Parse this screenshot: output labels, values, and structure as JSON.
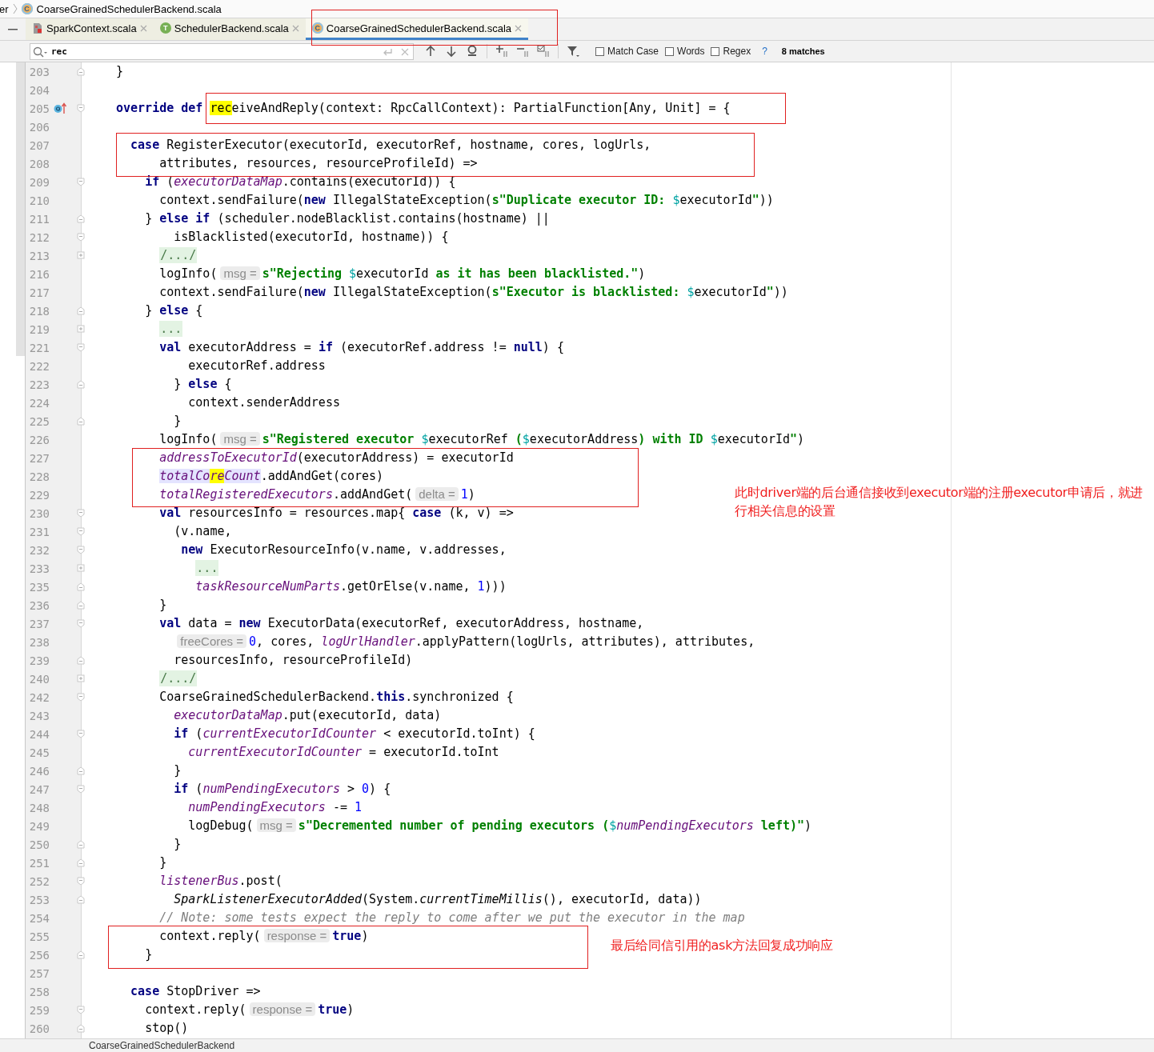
{
  "breadcrumb": {
    "lead": "er",
    "file": "CoarseGrainedSchedulerBackend.scala",
    "badge": "C"
  },
  "tabs": [
    {
      "label": "SparkContext.scala",
      "kind": "file",
      "selected": false
    },
    {
      "label": "SchedulerBackend.scala",
      "kind": "trait",
      "badge": "T",
      "selected": false
    },
    {
      "label": "CoarseGrainedSchedulerBackend.scala",
      "kind": "class",
      "badge": "C",
      "selected": true
    }
  ],
  "search": {
    "value": "rec",
    "options": [
      {
        "label": "Match Case",
        "checked": false
      },
      {
        "label": "Words",
        "checked": false
      },
      {
        "label": "Regex",
        "checked": false
      }
    ],
    "help": "?",
    "matches": "8 matches"
  },
  "editor": {
    "lines": [
      {
        "num": "203",
        "fold": {
          "kind": "end"
        },
        "tokens": [
          {
            "kind": "t",
            "text": "}"
          }
        ]
      },
      {
        "num": "204"
      },
      {
        "num": "205",
        "fold": {
          "kind": "start"
        },
        "gutter_icon": {
          "kind": "override"
        },
        "tokens": [
          {
            "kind": "kw",
            "text": "override"
          },
          {
            "kind": "kw",
            "text": " def "
          },
          {
            "kind": "match",
            "text": "rec"
          },
          {
            "kind": "t",
            "text": "eiveAndReply(context: RpcCallContext): PartialFunction[Any, Unit] = {"
          }
        ]
      },
      {
        "num": "206"
      },
      {
        "num": "207",
        "tokens": [
          {
            "kind": "kw",
            "text": "  case"
          },
          {
            "kind": "t",
            "text": " RegisterExecutor(executorId, executorRef, hostname, cores, logUrls,"
          }
        ]
      },
      {
        "num": "208",
        "tokens": [
          {
            "kind": "t",
            "text": "      attributes, resources, resourceProfileId) =>"
          }
        ]
      },
      {
        "num": "209",
        "fold": {
          "kind": "start"
        },
        "tokens": [
          {
            "kind": "kw",
            "text": "    if"
          },
          {
            "kind": "t",
            "text": " ("
          },
          {
            "kind": "fld",
            "text": "executorDataMap"
          },
          {
            "kind": "t",
            "text": ".contains(executorId)) {"
          }
        ]
      },
      {
        "num": "210",
        "tokens": [
          {
            "kind": "t",
            "text": "      context.sendFailure("
          },
          {
            "kind": "kw",
            "text": "new"
          },
          {
            "kind": "t",
            "text": " IllegalStateException("
          },
          {
            "kind": "str",
            "text": "s\"Duplicate executor ID: "
          },
          {
            "kind": "var",
            "text": "$"
          },
          {
            "kind": "t",
            "text": "executorId"
          },
          {
            "kind": "str",
            "text": "\""
          },
          {
            "kind": "t",
            "text": "))"
          }
        ]
      },
      {
        "num": "211",
        "fold": {
          "kind": "end"
        },
        "tokens": [
          {
            "kind": "t",
            "text": "    } "
          },
          {
            "kind": "kw",
            "text": "else"
          },
          {
            "kind": "kw",
            "text": " if"
          },
          {
            "kind": "t",
            "text": " (scheduler.nodeBlacklist.contains(hostname) ||"
          }
        ]
      },
      {
        "num": "212",
        "fold": {
          "kind": "start"
        },
        "tokens": [
          {
            "kind": "t",
            "text": "        isBlacklisted(executorId, hostname)) {"
          }
        ]
      },
      {
        "num": "213",
        "fold": {
          "kind": "collapsed"
        },
        "tokens": [
          {
            "kind": "fold",
            "text": "      /.../"
          }
        ]
      },
      {
        "num": "216",
        "tokens": [
          {
            "kind": "t",
            "text": "      logInfo("
          },
          {
            "kind": "hint",
            "text": "msg ="
          },
          {
            "kind": "str",
            "text": "s\"Rejecting "
          },
          {
            "kind": "var",
            "text": "$"
          },
          {
            "kind": "t",
            "text": "executorId"
          },
          {
            "kind": "str",
            "text": " as it has been blacklisted.\""
          },
          {
            "kind": "t",
            "text": ")"
          }
        ]
      },
      {
        "num": "217",
        "tokens": [
          {
            "kind": "t",
            "text": "      context.sendFailure("
          },
          {
            "kind": "kw",
            "text": "new"
          },
          {
            "kind": "t",
            "text": " IllegalStateException("
          },
          {
            "kind": "str",
            "text": "s\"Executor is blacklisted: "
          },
          {
            "kind": "var",
            "text": "$"
          },
          {
            "kind": "t",
            "text": "executorId"
          },
          {
            "kind": "str",
            "text": "\""
          },
          {
            "kind": "t",
            "text": "))"
          }
        ]
      },
      {
        "num": "218",
        "fold": {
          "kind": "end"
        },
        "tokens": [
          {
            "kind": "t",
            "text": "    } "
          },
          {
            "kind": "kw",
            "text": "else"
          },
          {
            "kind": "t",
            "text": " {"
          }
        ]
      },
      {
        "num": "219",
        "fold": {
          "kind": "collapsed"
        },
        "tokens": [
          {
            "kind": "fold",
            "text": "      ..."
          }
        ]
      },
      {
        "num": "221",
        "fold": {
          "kind": "start"
        },
        "tokens": [
          {
            "kind": "kw",
            "text": "      val"
          },
          {
            "kind": "t",
            "text": " executorAddress = "
          },
          {
            "kind": "kw",
            "text": "if"
          },
          {
            "kind": "t",
            "text": " (executorRef.address != "
          },
          {
            "kind": "kw",
            "text": "null"
          },
          {
            "kind": "t",
            "text": ") {"
          }
        ]
      },
      {
        "num": "222",
        "tokens": [
          {
            "kind": "t",
            "text": "          executorRef.address"
          }
        ]
      },
      {
        "num": "223",
        "fold": {
          "kind": "end"
        },
        "tokens": [
          {
            "kind": "t",
            "text": "        } "
          },
          {
            "kind": "kw",
            "text": "else"
          },
          {
            "kind": "t",
            "text": " {"
          }
        ]
      },
      {
        "num": "224",
        "tokens": [
          {
            "kind": "t",
            "text": "          context.senderAddress"
          }
        ]
      },
      {
        "num": "225",
        "fold": {
          "kind": "end"
        },
        "tokens": [
          {
            "kind": "t",
            "text": "        }"
          }
        ]
      },
      {
        "num": "226",
        "tokens": [
          {
            "kind": "t",
            "text": "      logInfo("
          },
          {
            "kind": "hint",
            "text": "msg ="
          },
          {
            "kind": "str",
            "text": "s\"Registered executor "
          },
          {
            "kind": "var",
            "text": "$"
          },
          {
            "kind": "t",
            "text": "executorRef"
          },
          {
            "kind": "str",
            "text": " ("
          },
          {
            "kind": "var",
            "text": "$"
          },
          {
            "kind": "t",
            "text": "executorAddress"
          },
          {
            "kind": "str",
            "text": ") with ID "
          },
          {
            "kind": "var",
            "text": "$"
          },
          {
            "kind": "t",
            "text": "executorId"
          },
          {
            "kind": "str",
            "text": "\""
          },
          {
            "kind": "t",
            "text": ")"
          }
        ]
      },
      {
        "num": "227",
        "tokens": [
          {
            "kind": "fld",
            "text": "      addressToExecutorId"
          },
          {
            "kind": "t",
            "text": "(executorAddress) = executorId"
          }
        ]
      },
      {
        "num": "228",
        "tokens": [
          {
            "kind": "fldsel",
            "text": "      totalCo"
          },
          {
            "kind": "fldmatch",
            "text": "re"
          },
          {
            "kind": "fldsel",
            "text": "Count"
          },
          {
            "kind": "t",
            "text": ".addAndGet(cores)"
          }
        ]
      },
      {
        "num": "229",
        "tokens": [
          {
            "kind": "fld",
            "text": "      totalRegisteredExecutors"
          },
          {
            "kind": "t",
            "text": ".addAndGet("
          },
          {
            "kind": "hint",
            "text": "delta ="
          },
          {
            "kind": "num",
            "text": "1"
          },
          {
            "kind": "t",
            "text": ")"
          }
        ]
      },
      {
        "num": "230",
        "fold": {
          "kind": "start"
        },
        "tokens": [
          {
            "kind": "kw",
            "text": "      val"
          },
          {
            "kind": "t",
            "text": " resourcesInfo = resources.map{ "
          },
          {
            "kind": "kw",
            "text": "case"
          },
          {
            "kind": "t",
            "text": " (k, v) =>"
          }
        ]
      },
      {
        "num": "231",
        "fold": {
          "kind": "start"
        },
        "tokens": [
          {
            "kind": "t",
            "text": "        (v.name,"
          }
        ]
      },
      {
        "num": "232",
        "fold": {
          "kind": "start"
        },
        "tokens": [
          {
            "kind": "kw",
            "text": "         new"
          },
          {
            "kind": "t",
            "text": " ExecutorResourceInfo(v.name, v.addresses,"
          }
        ]
      },
      {
        "num": "233",
        "fold": {
          "kind": "collapsed"
        },
        "tokens": [
          {
            "kind": "fold",
            "text": "           ..."
          }
        ]
      },
      {
        "num": "235",
        "fold": {
          "kind": "end"
        },
        "tokens": [
          {
            "kind": "fld",
            "text": "           taskResourceNumParts"
          },
          {
            "kind": "t",
            "text": ".getOrElse(v.name, "
          },
          {
            "kind": "num",
            "text": "1"
          },
          {
            "kind": "t",
            "text": ")))"
          }
        ]
      },
      {
        "num": "236",
        "fold": {
          "kind": "end"
        },
        "tokens": [
          {
            "kind": "t",
            "text": "      }"
          }
        ]
      },
      {
        "num": "237",
        "fold": {
          "kind": "start"
        },
        "tokens": [
          {
            "kind": "kw",
            "text": "      val"
          },
          {
            "kind": "t",
            "text": " data = "
          },
          {
            "kind": "kw",
            "text": "new"
          },
          {
            "kind": "t",
            "text": " ExecutorData(executorRef, executorAddress, hostname,"
          }
        ]
      },
      {
        "num": "238",
        "tokens": [
          {
            "kind": "hint",
            "text": "        freeCores ="
          },
          {
            "kind": "num",
            "text": "0"
          },
          {
            "kind": "t",
            "text": ", cores, "
          },
          {
            "kind": "fld",
            "text": "logUrlHandler"
          },
          {
            "kind": "t",
            "text": ".applyPattern(logUrls, attributes), attributes,"
          }
        ]
      },
      {
        "num": "239",
        "fold": {
          "kind": "end"
        },
        "tokens": [
          {
            "kind": "t",
            "text": "        resourcesInfo, resourceProfileId)"
          }
        ]
      },
      {
        "num": "240",
        "fold": {
          "kind": "collapsed"
        },
        "tokens": [
          {
            "kind": "fold",
            "text": "      /.../"
          }
        ]
      },
      {
        "num": "242",
        "fold": {
          "kind": "start"
        },
        "tokens": [
          {
            "kind": "t",
            "text": "      CoarseGrainedSchedulerBackend."
          },
          {
            "kind": "kw",
            "text": "this"
          },
          {
            "kind": "t",
            "text": ".synchronized {"
          }
        ]
      },
      {
        "num": "243",
        "tokens": [
          {
            "kind": "fld",
            "text": "        executorDataMap"
          },
          {
            "kind": "t",
            "text": ".put(executorId, data)"
          }
        ]
      },
      {
        "num": "244",
        "fold": {
          "kind": "start"
        },
        "tokens": [
          {
            "kind": "kw",
            "text": "        if"
          },
          {
            "kind": "t",
            "text": " ("
          },
          {
            "kind": "fld",
            "text": "currentExecutorIdCounter"
          },
          {
            "kind": "t",
            "text": " < executorId.toInt) {"
          }
        ]
      },
      {
        "num": "245",
        "tokens": [
          {
            "kind": "fld",
            "text": "          currentExecutorIdCounter"
          },
          {
            "kind": "t",
            "text": " = executorId.toInt"
          }
        ]
      },
      {
        "num": "246",
        "fold": {
          "kind": "end"
        },
        "tokens": [
          {
            "kind": "t",
            "text": "        }"
          }
        ]
      },
      {
        "num": "247",
        "fold": {
          "kind": "start"
        },
        "tokens": [
          {
            "kind": "kw",
            "text": "        if"
          },
          {
            "kind": "t",
            "text": " ("
          },
          {
            "kind": "fld",
            "text": "numPendingExecutors"
          },
          {
            "kind": "t",
            "text": " > "
          },
          {
            "kind": "num",
            "text": "0"
          },
          {
            "kind": "t",
            "text": ") {"
          }
        ]
      },
      {
        "num": "248",
        "tokens": [
          {
            "kind": "fld",
            "text": "          numPendingExecutors"
          },
          {
            "kind": "t",
            "text": " -= "
          },
          {
            "kind": "num",
            "text": "1"
          }
        ]
      },
      {
        "num": "249",
        "tokens": [
          {
            "kind": "t",
            "text": "          logDebug("
          },
          {
            "kind": "hint",
            "text": "msg ="
          },
          {
            "kind": "str",
            "text": "s\"Decremented number of pending executors ("
          },
          {
            "kind": "var",
            "text": "$"
          },
          {
            "kind": "fld",
            "text": "numPendingExecutors"
          },
          {
            "kind": "str",
            "text": " left)\""
          },
          {
            "kind": "t",
            "text": ")"
          }
        ]
      },
      {
        "num": "250",
        "fold": {
          "kind": "end"
        },
        "tokens": [
          {
            "kind": "t",
            "text": "        }"
          }
        ]
      },
      {
        "num": "251",
        "fold": {
          "kind": "end"
        },
        "tokens": [
          {
            "kind": "t",
            "text": "      }"
          }
        ]
      },
      {
        "num": "252",
        "fold": {
          "kind": "start"
        },
        "tokens": [
          {
            "kind": "fld",
            "text": "      listenerBus"
          },
          {
            "kind": "t",
            "text": ".post("
          }
        ]
      },
      {
        "num": "253",
        "fold": {
          "kind": "end"
        },
        "tokens": [
          {
            "kind": "it",
            "text": "        SparkListenerExecutorAdded"
          },
          {
            "kind": "t",
            "text": "(System."
          },
          {
            "kind": "it",
            "text": "currentTimeMillis"
          },
          {
            "kind": "t",
            "text": "(), executorId, data))"
          }
        ]
      },
      {
        "num": "254",
        "tokens": [
          {
            "kind": "cmt",
            "text": "      // Note: some tests expect the reply to come after we put the executor in the map"
          }
        ]
      },
      {
        "num": "255",
        "tokens": [
          {
            "kind": "t",
            "text": "      context.reply("
          },
          {
            "kind": "hint",
            "text": "response ="
          },
          {
            "kind": "kw",
            "text": "true"
          },
          {
            "kind": "t",
            "text": ")"
          }
        ]
      },
      {
        "num": "256",
        "fold": {
          "kind": "end"
        },
        "tokens": [
          {
            "kind": "t",
            "text": "    }"
          }
        ]
      },
      {
        "num": "257"
      },
      {
        "num": "258",
        "tokens": [
          {
            "kind": "kw",
            "text": "  case"
          },
          {
            "kind": "t",
            "text": " StopDriver =>"
          }
        ]
      },
      {
        "num": "259",
        "fold": {
          "kind": "start"
        },
        "tokens": [
          {
            "kind": "t",
            "text": "    context.reply("
          },
          {
            "kind": "hint",
            "text": "response ="
          },
          {
            "kind": "kw",
            "text": "true"
          },
          {
            "kind": "t",
            "text": ")"
          }
        ]
      },
      {
        "num": "260",
        "fold": {
          "kind": "end"
        },
        "tokens": [
          {
            "kind": "t",
            "text": "    stop()"
          }
        ]
      }
    ]
  },
  "annotations": [
    {
      "text": "此时driver端的后台通信接收到executor端的注册executor申请后，就进行相关信息的设置"
    },
    {
      "text": "最后给同信引用的ask方法回复成功响应"
    }
  ],
  "status_bar": {
    "breadcrumb": "CoarseGrainedSchedulerBackend"
  }
}
